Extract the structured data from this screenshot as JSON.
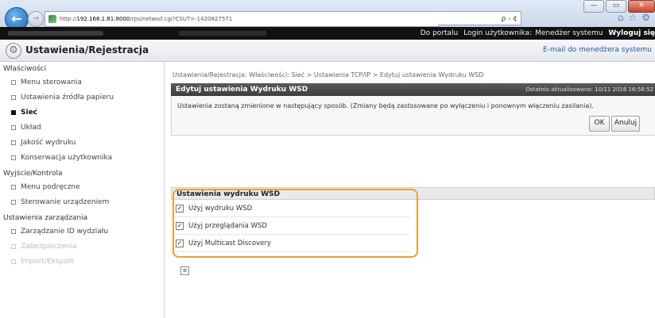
{
  "browser": {
    "url_host": "192.168.1.81:8000",
    "url_rest": "/rps/netwsd.cgi?CSUT=-1420827571",
    "url_prefix": "http://",
    "search_text": "ρ - ¢",
    "win_minimize": "—",
    "win_maximize": "▭",
    "win_close": "✕"
  },
  "topbar": {
    "portal_link": "Do portalu",
    "login_label": "Login użytkownika:",
    "user": "Menedżer systemu",
    "logout": "Wyloguj się"
  },
  "header": {
    "title": "Ustawienia/Rejestracja",
    "mail_link": "E-mail do menedżera systemu"
  },
  "sidebar": {
    "sections": [
      {
        "title": "Właściwości",
        "items": [
          {
            "label": "Menu sterowania",
            "state": "normal"
          },
          {
            "label": "Ustawienia źródła papieru",
            "state": "normal"
          },
          {
            "label": "Sieć",
            "state": "active"
          },
          {
            "label": "Układ",
            "state": "normal"
          },
          {
            "label": "Jakość wydruku",
            "state": "normal"
          },
          {
            "label": "Konserwacja użytkownika",
            "state": "normal"
          }
        ]
      },
      {
        "title": "Wyjście/Kontrola",
        "items": [
          {
            "label": "Menu podręczne",
            "state": "normal"
          },
          {
            "label": "Sterowanie urządzeniem",
            "state": "normal"
          }
        ]
      },
      {
        "title": "Ustawienia zarządzania",
        "items": [
          {
            "label": "Zarządzanie ID wydziału",
            "state": "normal"
          },
          {
            "label": "Zabezpieczenia",
            "state": "faded"
          },
          {
            "label": "Import/Eksport",
            "state": "faded"
          }
        ]
      }
    ]
  },
  "main": {
    "breadcrumb": "Ustawienia/Rejestracja: Właściwości: Sieć > Ustawienia TCP/IP > Edytuj ustawienia Wydruku WSD",
    "panel_title": "Edytuj ustawienia Wydruku WSD",
    "last_updated": "Ostatnio aktualizowano: 10/11 2016 16:58:52",
    "message": "Ustawienia zostaną zmienione w następujący sposób. (Zmiany będą zastosowane po wyłączeniu i ponownym włączeniu zasilania).",
    "ok_label": "OK",
    "cancel_label": "Anuluj",
    "settings_title": "Ustawienia wydruku WSD",
    "settings": [
      {
        "label": "Użyj wydruku WSD",
        "checked": true
      },
      {
        "label": "Użyj przeglądania WSD",
        "checked": true
      },
      {
        "label": "Użyj Multicast Discovery",
        "checked": true
      }
    ],
    "top_icon": "≡"
  },
  "colors": {
    "highlight": "#f0a030",
    "panel_header": "#444444",
    "link": "#2159a3"
  }
}
